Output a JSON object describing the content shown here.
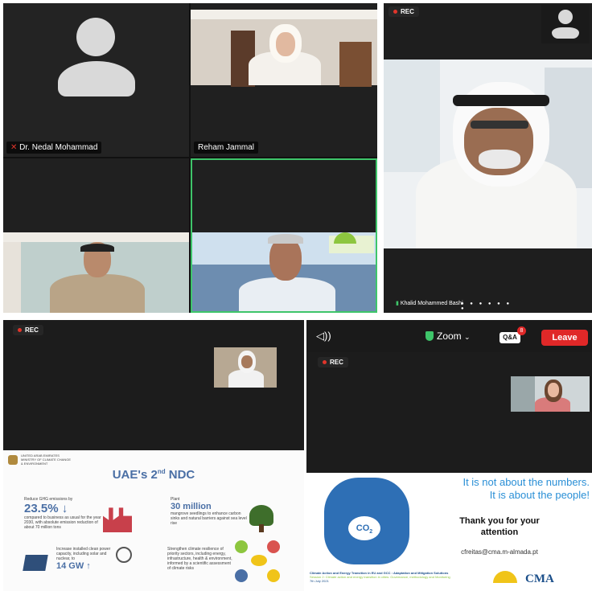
{
  "top_left": {
    "tiles": [
      {
        "name": "Dr. Nedal Mohammad",
        "muted": true
      },
      {
        "name": "Reham Jammal"
      },
      {
        "name": ""
      },
      {
        "name": ""
      }
    ]
  },
  "top_right": {
    "rec_label": "REC",
    "speaker_name": "Khalid Mohammed Bashi"
  },
  "bottom_left": {
    "rec_label": "REC",
    "slide": {
      "org_line1": "UNITED ARAB EMIRATES",
      "org_line2": "MINISTRY OF CLIMATE CHANGE",
      "org_line3": "& ENVIRONMENT",
      "title": "UAE's 2",
      "title_sup": "nd",
      "title_end": " NDC",
      "item1_head": "Reduce GHG emissions by",
      "item1_value": "23.5%",
      "item1_arrow": "↓",
      "item1_text": "compared to business as usual for the year 2030, with absolute emission reduction of about 70 million tons",
      "item2_head": "Plant",
      "item2_value": "30 million",
      "item2_text": "mangrove seedlings to enhance carbon sinks and natural barriers against sea level rise",
      "item3_head": "Increase installed clean power capacity, including solar and nuclear, to",
      "item3_value": "14 GW",
      "item3_arrow": "↑",
      "item4_text": "Strengthen climate resilience of priority sectors, including energy, infrastructure, health & environment, informed by a scientific assessment of climate risks"
    }
  },
  "bottom_right": {
    "audio_icon": "speaker-icon",
    "app_name": "Zoom",
    "qa_label": "Q&A",
    "qa_count": "8",
    "leave_label": "Leave",
    "rec_label": "REC",
    "slide": {
      "line1": "It is not about the numbers.",
      "line2": "It is about the people!",
      "thanks1": "Thank you for your",
      "thanks2": "attention",
      "email": "cfreitas@cma.m-almada.pt",
      "co2": "CO",
      "co2_sub": "2",
      "footer1": "Climate Action and Energy Transition in EU and GCC : Adaptation and Mitigation Solutions",
      "footer2": "Session 2: Climate action and energy transition in cities: Governance, methodology and Monitoring",
      "footer3": "7th July 2021",
      "logo": "CMA"
    },
    "accent_green": "#8dc63f",
    "accent_blue": "#2a8fd6"
  }
}
